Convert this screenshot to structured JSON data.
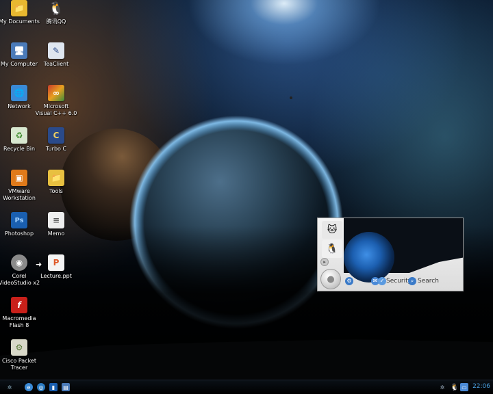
{
  "desktop_icons": [
    {
      "label": "My Documents",
      "icon": "folder-documents-icon",
      "color": "#e8b830",
      "glyph": "📁"
    },
    {
      "label": "腾讯QQ",
      "icon": "qq-penguin-icon",
      "color": "#222222",
      "glyph": "🐧"
    },
    {
      "label": "My Computer",
      "icon": "computer-icon",
      "color": "#4a7ab8",
      "glyph": "🖥"
    },
    {
      "label": "TeaClient",
      "icon": "teaclient-icon",
      "color": "#dfe6ef",
      "glyph": "✎"
    },
    {
      "label": "Network",
      "icon": "network-icon",
      "color": "#3a8ad6",
      "glyph": "🌐"
    },
    {
      "label": "Microsoft Visual C++ 6.0",
      "icon": "visual-cpp-icon",
      "color": "#c83a2a",
      "glyph": "∞"
    },
    {
      "label": "Recycle Bin",
      "icon": "recycle-bin-icon",
      "color": "#5ca04a",
      "glyph": "♻"
    },
    {
      "label": "Turbo C",
      "icon": "turbo-c-icon",
      "color": "#2a4a8a",
      "glyph": "C"
    },
    {
      "label": "VMware Workstation",
      "icon": "vmware-icon",
      "color": "#e07a1a",
      "glyph": "▣"
    },
    {
      "label": "Tools",
      "icon": "folder-icon",
      "color": "#e8c040",
      "glyph": "📁"
    },
    {
      "label": "Photoshop",
      "icon": "photoshop-icon",
      "color": "#1a5fb0",
      "glyph": "Ps"
    },
    {
      "label": "Memo",
      "icon": "notepad-icon",
      "color": "#eeeeee",
      "glyph": "≡"
    },
    {
      "label": "Corel VideoStudio x2",
      "icon": "corel-videostudio-icon",
      "color": "#8a8a8a",
      "glyph": "◉"
    },
    {
      "label": "Lecture.ppt",
      "icon": "ppt-file-icon",
      "color": "#e05a2a",
      "glyph": "P"
    },
    {
      "label": "Macromedia Flash 8",
      "icon": "flash-icon",
      "color": "#c8201a",
      "glyph": "f"
    },
    {
      "label": "Cisco Packet Tracer",
      "icon": "packet-tracer-icon",
      "color": "#5a7a3a",
      "glyph": "⚙"
    }
  ],
  "qq_panel": {
    "security_label": "Security",
    "search_label": "Search"
  },
  "taskbar": {
    "clock": "22:06"
  }
}
